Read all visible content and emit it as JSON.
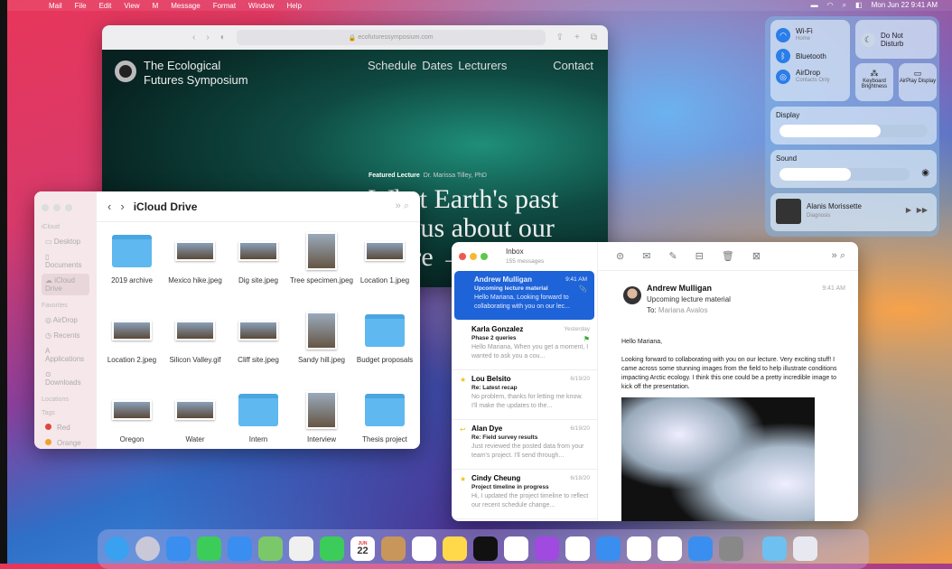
{
  "menubar": {
    "items": [
      "Mail",
      "File",
      "Edit",
      "View",
      "M",
      "Message",
      "Format",
      "Window",
      "Help"
    ],
    "clock": "Mon Jun 22  9:41 AM"
  },
  "browser": {
    "url": "ecofuturessymposium.com",
    "site_title_line1": "The Ecological",
    "site_title_line2": "Futures Symposium",
    "nav": [
      "Schedule",
      "Dates",
      "Lecturers",
      "Contact"
    ],
    "featured_label": "Featured Lecture",
    "featured_speaker": "Dr. Marissa Tilley, PhD",
    "headline": "What Earth's past tells us about our future →"
  },
  "finder": {
    "title": "iCloud Drive",
    "sidebar": {
      "icloud_header": "iCloud",
      "icloud": [
        "Desktop",
        "Documents",
        "iCloud Drive"
      ],
      "favorites_header": "Favorites",
      "favorites": [
        "AirDrop",
        "Recents",
        "Applications",
        "Downloads"
      ],
      "locations_header": "Locations",
      "tags_header": "Tags",
      "tags": [
        {
          "label": "Red",
          "color": "#e0453a"
        },
        {
          "label": "Orange",
          "color": "#f0a030"
        }
      ]
    },
    "files": [
      {
        "name": "2019 archive",
        "kind": "folder"
      },
      {
        "name": "Mexico hike.jpeg",
        "kind": "image"
      },
      {
        "name": "Dig site.jpeg",
        "kind": "image"
      },
      {
        "name": "Tree specimen.jpeg",
        "kind": "tall"
      },
      {
        "name": "Location 1.jpeg",
        "kind": "image"
      },
      {
        "name": "Location 2.jpeg",
        "kind": "image"
      },
      {
        "name": "Silicon Valley.gif",
        "kind": "image"
      },
      {
        "name": "Cliff site.jpeg",
        "kind": "image"
      },
      {
        "name": "Sandy hill.jpeg",
        "kind": "tall"
      },
      {
        "name": "Budget proposals",
        "kind": "folder"
      },
      {
        "name": "Oregon",
        "kind": "image"
      },
      {
        "name": "Water",
        "kind": "image"
      },
      {
        "name": "Intern",
        "kind": "folder"
      },
      {
        "name": "Interview",
        "kind": "tall"
      },
      {
        "name": "Thesis project",
        "kind": "folder"
      }
    ]
  },
  "mail": {
    "mailbox": "Inbox",
    "count": "155 messages",
    "messages": [
      {
        "from": "Andrew Mulligan",
        "date": "9:41 AM",
        "subject": "Upcoming lecture material",
        "preview": "Hello Mariana, Looking forward to collaborating with you on our lec..."
      },
      {
        "from": "Karla Gonzalez",
        "date": "Yesterday",
        "subject": "Phase 2 queries",
        "preview": "Hello Mariana, When you get a moment, I wanted to ask you a cou..."
      },
      {
        "from": "Lou Belsito",
        "date": "6/19/20",
        "subject": "Re: Latest recap",
        "preview": "No problem, thanks for letting me know. I'll make the updates to the..."
      },
      {
        "from": "Alan Dye",
        "date": "6/19/20",
        "subject": "Re: Field survey results",
        "preview": "Just reviewed the posted data from your team's project. I'll send through..."
      },
      {
        "from": "Cindy Cheung",
        "date": "6/18/20",
        "subject": "Project timeline in progress",
        "preview": "Hi, I updated the project timeline to reflect our recent schedule change..."
      }
    ],
    "open": {
      "from": "Andrew Mulligan",
      "subject": "Upcoming lecture material",
      "to_label": "To:",
      "to": "Mariana Avalos",
      "time": "9:41 AM",
      "greeting": "Hello Mariana,",
      "body": "Looking forward to collaborating with you on our lecture. Very exciting stuff! I came across some stunning images from the field to help illustrate conditions impacting Arctic ecology. I think this one could be a pretty incredible image to kick off the presentation."
    }
  },
  "control_center": {
    "wifi": "Wi-Fi",
    "wifi_sub": "Home",
    "bluetooth": "Bluetooth",
    "airdrop": "AirDrop",
    "airdrop_sub": "Contacts Only",
    "dnd": "Do Not Disturb",
    "keyboard": "Keyboard Brightness",
    "airplay": "AirPlay Display",
    "display": "Display",
    "display_level": 0.68,
    "sound": "Sound",
    "sound_level": 0.55,
    "now_playing_artist": "Alanis Morissette",
    "now_playing_title": "Diagnosis"
  },
  "dock": {
    "calendar_month": "JUN",
    "calendar_day": "22",
    "apps": [
      {
        "name": "finder",
        "color": "#3aa0f0"
      },
      {
        "name": "launchpad",
        "color": "#c8c8d8"
      },
      {
        "name": "safari",
        "color": "#3a8ef0"
      },
      {
        "name": "messages",
        "color": "#3ccc5a"
      },
      {
        "name": "mail",
        "color": "#3a8ef0"
      },
      {
        "name": "maps",
        "color": "#7ac86a"
      },
      {
        "name": "photos",
        "color": "#f0f0f0"
      },
      {
        "name": "facetime",
        "color": "#3ccc5a"
      },
      {
        "name": "calendar",
        "color": "#ffffff"
      },
      {
        "name": "contacts",
        "color": "#c8965a"
      },
      {
        "name": "reminders",
        "color": "#ffffff"
      },
      {
        "name": "notes",
        "color": "#ffd94a"
      },
      {
        "name": "tv",
        "color": "#111111"
      },
      {
        "name": "music",
        "color": "#ffffff"
      },
      {
        "name": "podcasts",
        "color": "#a04ae0"
      },
      {
        "name": "news",
        "color": "#ffffff"
      },
      {
        "name": "keynote",
        "color": "#3a8ef0"
      },
      {
        "name": "numbers",
        "color": "#ffffff"
      },
      {
        "name": "pages",
        "color": "#ffffff"
      },
      {
        "name": "app-store",
        "color": "#3a8ef0"
      },
      {
        "name": "system-preferences",
        "color": "#888888"
      },
      {
        "name": "downloads-folder",
        "color": "#6ec0f0"
      },
      {
        "name": "trash",
        "color": "#e8e8f0"
      }
    ]
  }
}
